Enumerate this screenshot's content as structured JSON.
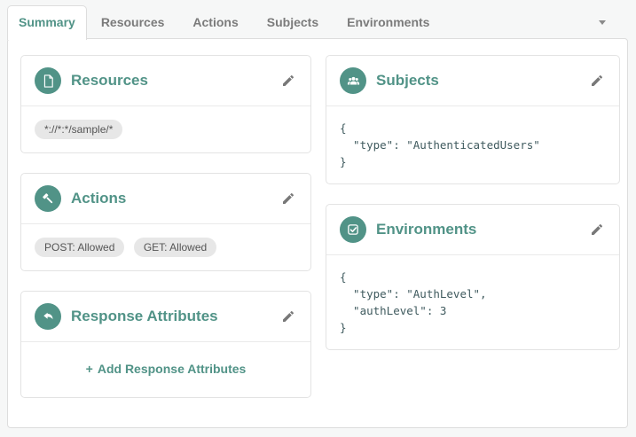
{
  "colors": {
    "accent": "#519387",
    "inactive_tab_text": "#7b7b7b",
    "badge_bg": "#e7e7e7",
    "code_text": "#3f5a5e",
    "page_bg": "#f6f7f7"
  },
  "tabs": {
    "items": [
      {
        "label": "Summary",
        "active": true
      },
      {
        "label": "Resources",
        "active": false
      },
      {
        "label": "Actions",
        "active": false
      },
      {
        "label": "Subjects",
        "active": false
      },
      {
        "label": "Environments",
        "active": false
      }
    ],
    "overflow_icon": "caret-down-icon"
  },
  "cards": {
    "resources": {
      "title": "Resources",
      "icon": "file-icon",
      "badges": [
        "*://*:*/sample/*"
      ]
    },
    "actions": {
      "title": "Actions",
      "icon": "gavel-icon",
      "badges": [
        "POST: Allowed",
        "GET: Allowed"
      ]
    },
    "response_attributes": {
      "title": "Response Attributes",
      "icon": "reply-arrow-icon",
      "add_icon": "+",
      "add_label": "Add Response Attributes"
    },
    "subjects": {
      "title": "Subjects",
      "icon": "users-icon",
      "code": "{\n  \"type\": \"AuthenticatedUsers\"\n}"
    },
    "environments": {
      "title": "Environments",
      "icon": "check-square-icon",
      "code": "{\n  \"type\": \"AuthLevel\",\n  \"authLevel\": 3\n}"
    }
  },
  "edit_icon": "pencil-icon"
}
